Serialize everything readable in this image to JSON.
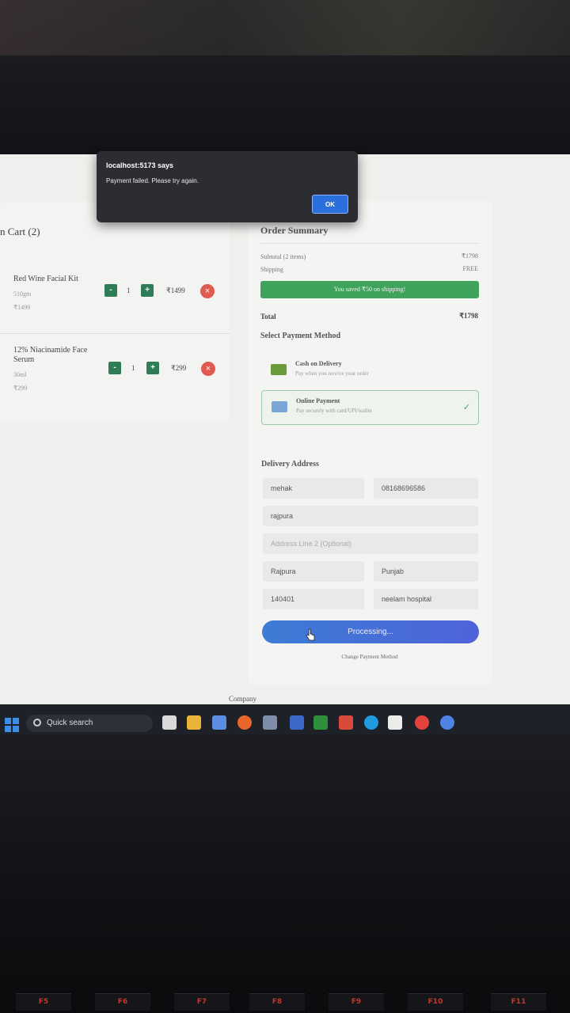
{
  "dialog": {
    "title": "localhost:5173 says",
    "message": "Payment failed. Please try again.",
    "ok_label": "OK"
  },
  "cart": {
    "title": "n Cart (2)",
    "items": [
      {
        "name": "Red Wine Facial Kit",
        "size": "510gm",
        "unit_price": "₹1499",
        "qty": "1",
        "line_price": "₹1499"
      },
      {
        "name_line1": "12% Niacinamide Face",
        "name_line2": "Serum",
        "size": "30ml",
        "unit_price": "₹299",
        "qty": "1",
        "line_price": "₹299"
      }
    ],
    "minus_label": "-",
    "plus_label": "+",
    "remove_label": "×"
  },
  "summary": {
    "title": "Order Summary",
    "subtotal_label": "Subtotal (2 items)",
    "subtotal_value": "₹1798",
    "shipping_label": "Shipping",
    "shipping_value": "FREE",
    "saved_text": "You saved ₹50 on shipping!",
    "total_label": "Total",
    "total_value": "₹1798",
    "payment_heading": "Select Payment Method",
    "payment_options": [
      {
        "title": "Cash on Delivery",
        "subtitle": "Pay when you receive your order",
        "selected": false
      },
      {
        "title": "Online Payment",
        "subtitle": "Pay securely with card/UPI/wallet",
        "selected": true
      }
    ],
    "check_mark": "✓"
  },
  "address": {
    "heading": "Delivery Address",
    "name": "mehak",
    "phone": "08168696586",
    "line1": "rajpura",
    "line2_placeholder": "Address Line 2 (Optional)",
    "city": "Rajpura",
    "state": "Punjab",
    "pincode": "140401",
    "landmark": "neelam hospital"
  },
  "actions": {
    "process_label": "Processing...",
    "change_method_label": "Change Payment Method"
  },
  "footer": {
    "company_label": "Company"
  },
  "taskbar": {
    "search_label": "Quick search"
  },
  "keyboard": {
    "keys": [
      "F5",
      "F6",
      "F7",
      "F8",
      "F9",
      "F10",
      "F11"
    ]
  },
  "colors": {
    "primary_green": "#3fa35c",
    "button_blue": "#4f63d8",
    "remove_red": "#e05a4f",
    "dialog_bg": "#2b2d33"
  }
}
